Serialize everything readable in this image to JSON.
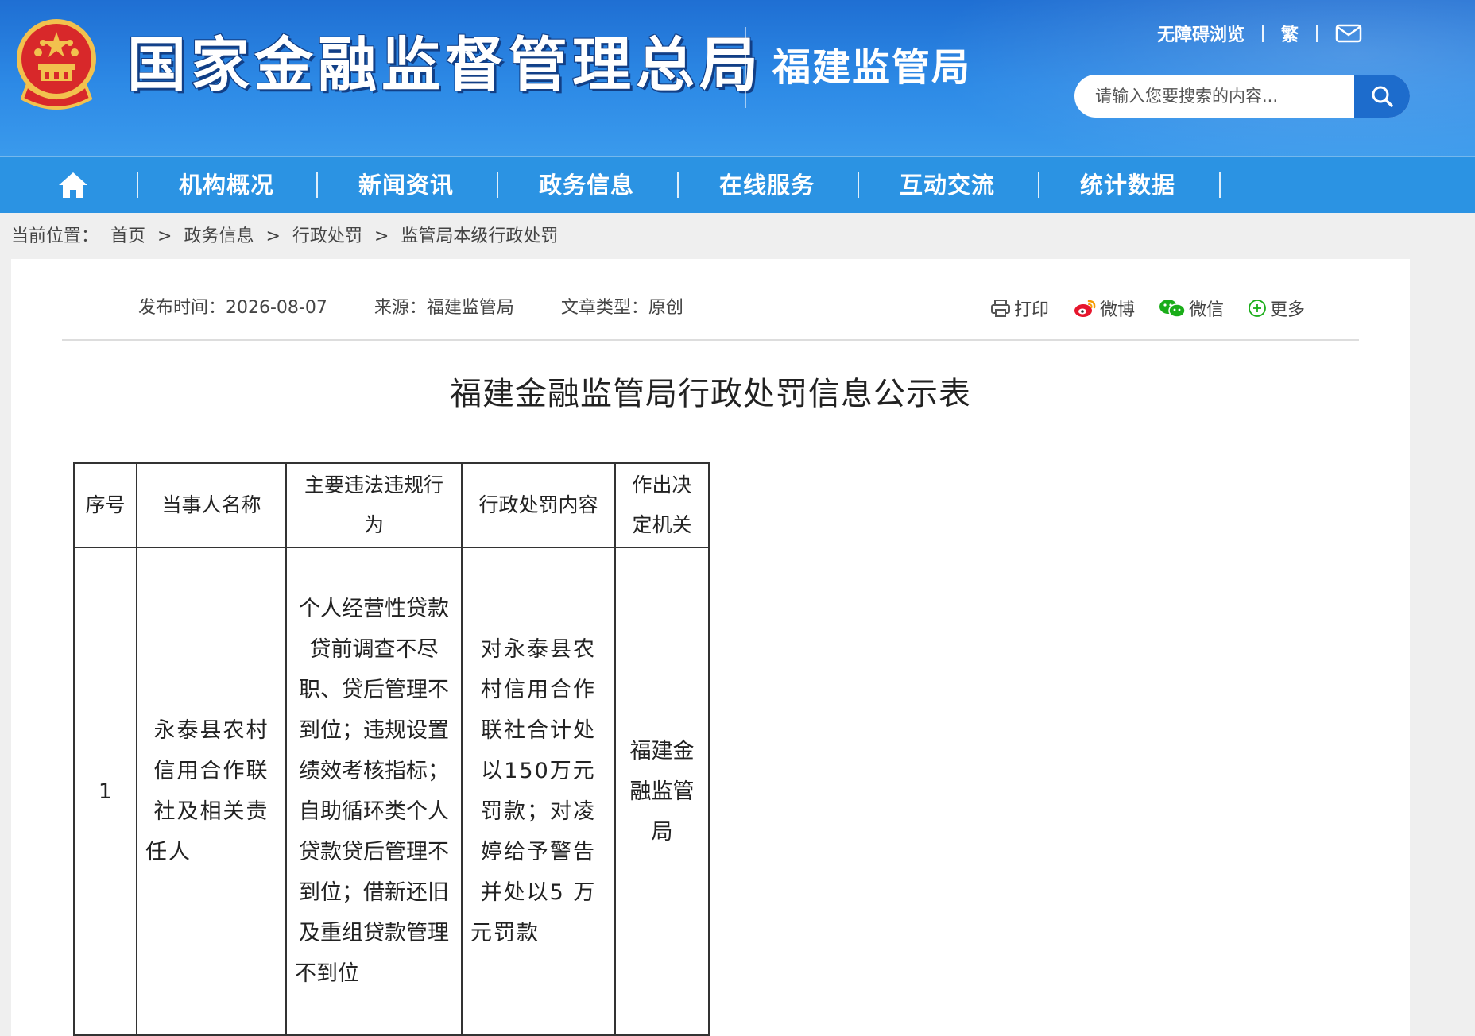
{
  "header": {
    "site_title": "国家金融监督管理总局",
    "sub_title": "福建监管局",
    "links": {
      "accessibility": "无障碍浏览",
      "traditional": "繁"
    },
    "search": {
      "placeholder": "请输入您要搜索的内容..."
    }
  },
  "nav": {
    "items": [
      "机构概况",
      "新闻资讯",
      "政务信息",
      "在线服务",
      "互动交流",
      "统计数据"
    ]
  },
  "breadcrumb": {
    "prefix": "当前位置：",
    "items": [
      "首页",
      "政务信息",
      "行政处罚",
      "监管局本级行政处罚"
    ],
    "separator": ">"
  },
  "article": {
    "meta": {
      "publish_time": "发布时间：2026-08-07",
      "source": "来源：福建监管局",
      "type": "文章类型：原创"
    },
    "share": {
      "print": "打印",
      "weibo": "微博",
      "wechat": "微信",
      "more": "更多"
    },
    "title": "福建金融监管局行政处罚信息公示表",
    "table": {
      "headers": [
        "序号",
        "当事人名称",
        "主要违法违规行为",
        "行政处罚内容",
        "作出决定机关"
      ],
      "rows": [
        {
          "index": "1",
          "party": "永泰县农村信用合作联社及相关责任人",
          "violation": "个人经营性贷款贷前调查不尽职、贷后管理不到位；违规设置绩效考核指标；自助循环类个人贷款贷后管理不到位；借新还旧及重组贷款管理不到位",
          "penalty": "对永泰县农村信用合作联社合计处以150万元罚款；对凌婷给予警告并处以5 万元罚款",
          "authority": "福建金融监管局"
        }
      ]
    }
  },
  "colors": {
    "header_blue": "#1f6fd3",
    "nav_blue": "#2b93e3",
    "search_button": "#1d6ccc",
    "wechat_green": "#1aad19",
    "weibo_red": "#e6162d"
  }
}
